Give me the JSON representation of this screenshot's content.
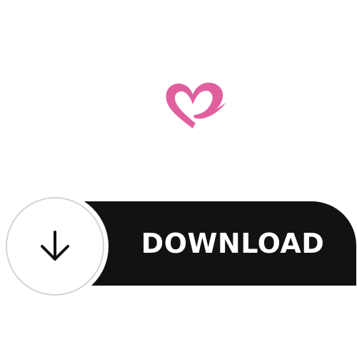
{
  "logo": {
    "icon": "heart-hand-icon",
    "color": "#e0609f"
  },
  "download": {
    "label": "DOWNLOAD",
    "icon": "arrow-down-icon",
    "bar_color": "#121212",
    "text_color": "#ffffff"
  }
}
